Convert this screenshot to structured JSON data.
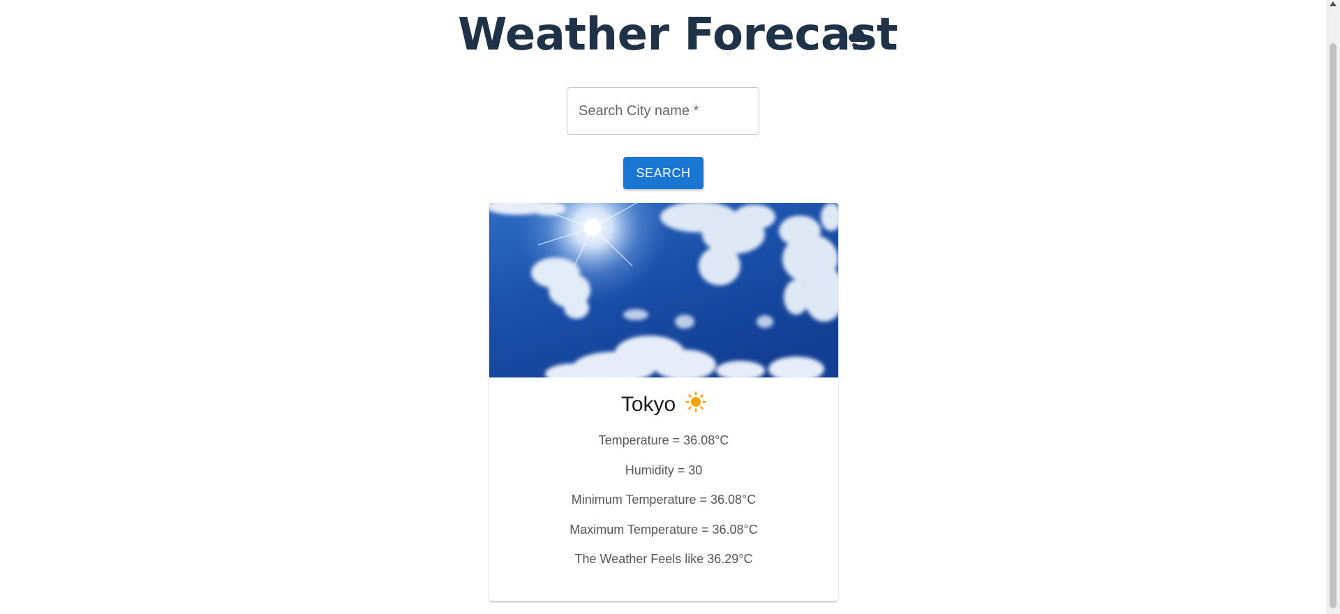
{
  "header": {
    "title": "Weather Forecast",
    "title_icon": "cloud-snow-icon"
  },
  "search": {
    "placeholder": "Search City name *",
    "value": "",
    "button_label": "SEARCH"
  },
  "card": {
    "image": "sunny-sky-image",
    "city": "Tokyo",
    "condition_icon": "sun-icon",
    "temperature": "Temperature = 36.08°C",
    "humidity": "Humidity = 30",
    "min_temperature": "Minimum Temperature = 36.08°C",
    "max_temperature": "Maximum Temperature = 36.08°C",
    "feels_like": "The Weather Feels like 36.29°C"
  },
  "colors": {
    "title": "#1e3248",
    "button": "#1976d2",
    "sun": "#f5a300",
    "sky": "#1a4fa8"
  }
}
